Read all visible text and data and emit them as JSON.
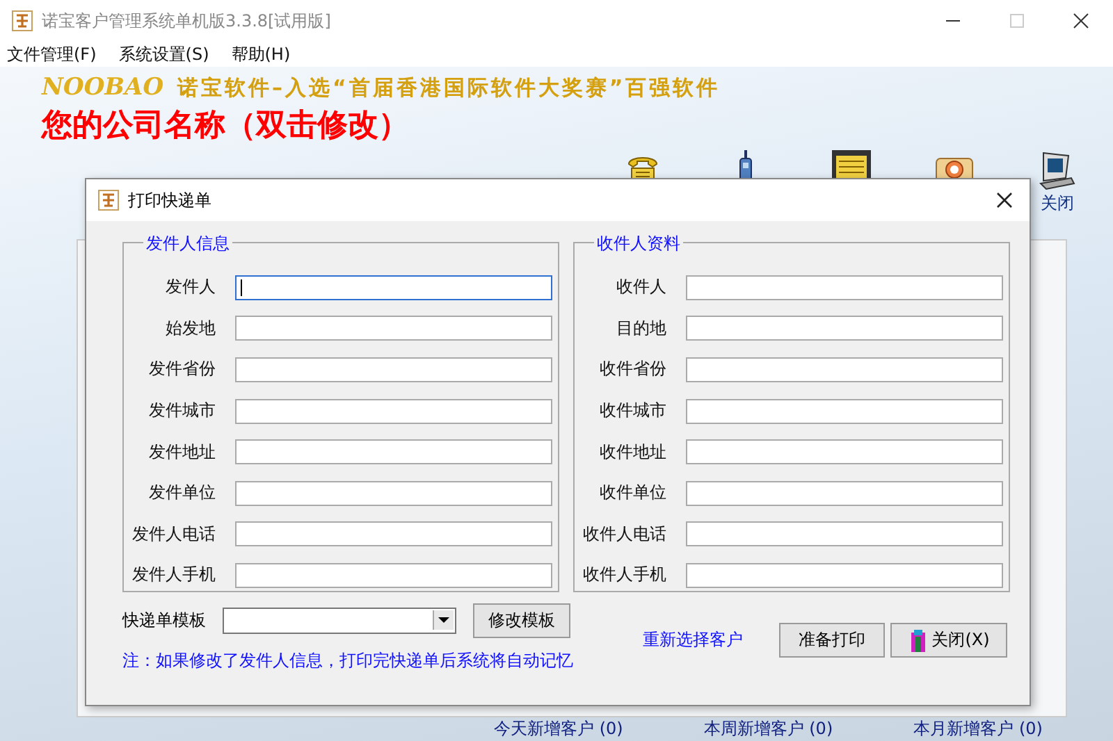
{
  "window": {
    "title": "诺宝客户管理系统单机版3.3.8[试用版]"
  },
  "menu": [
    {
      "label": "文件管理(F)"
    },
    {
      "label": "系统设置(S)"
    },
    {
      "label": "帮助(H)"
    }
  ],
  "banner": {
    "brand": "NOOBAO",
    "slogan": "诺宝软件–入选“首届香港国际软件大奖赛”百强软件",
    "company": "您的公司名称（双击修改）"
  },
  "toolbar": [
    {
      "kind": "phone"
    },
    {
      "kind": "handset"
    },
    {
      "kind": "monitor"
    },
    {
      "kind": "contacts"
    },
    {
      "kind": "exit",
      "label": "关闭"
    }
  ],
  "dialog": {
    "title": "打印快递单",
    "groups": [
      {
        "title": "发件人信息",
        "fields": [
          {
            "label": "发件人",
            "focused": true
          },
          {
            "label": "始发地",
            "focused": false
          },
          {
            "label": "发件省份",
            "focused": false
          },
          {
            "label": "发件城市",
            "focused": false
          },
          {
            "label": "发件地址",
            "focused": false
          },
          {
            "label": "发件单位",
            "focused": false
          },
          {
            "label": "发件人电话",
            "focused": false
          },
          {
            "label": "发件人手机",
            "focused": false
          }
        ]
      },
      {
        "title": "收件人资料",
        "fields": [
          {
            "label": "收件人",
            "focused": false
          },
          {
            "label": "目的地",
            "focused": false
          },
          {
            "label": "收件省份",
            "focused": false
          },
          {
            "label": "收件城市",
            "focused": false
          },
          {
            "label": "收件地址",
            "focused": false
          },
          {
            "label": "收件单位",
            "focused": false
          },
          {
            "label": "收件人电话",
            "focused": false
          },
          {
            "label": "收件人手机",
            "focused": false
          }
        ]
      }
    ],
    "template_label": "快递单模板",
    "edit_template_button": "修改模板",
    "reselect_link": "重新选择客户",
    "print_button": "准备打印",
    "close_button": "关闭(X)",
    "note": "注：如果修改了发件人信息，打印完快递单后系统将自动记忆"
  },
  "stats": [
    "今天新增客户 (0)",
    "本周新增客户 (0)",
    "本月新增客户 (0)"
  ]
}
